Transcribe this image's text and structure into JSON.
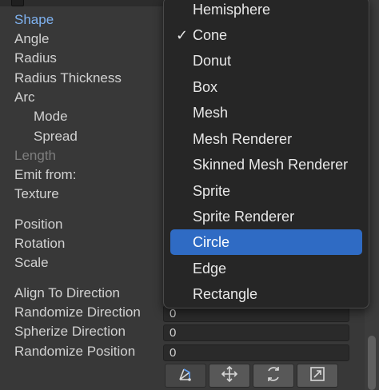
{
  "inspector": {
    "labels": {
      "shape": "Shape",
      "angle": "Angle",
      "radius": "Radius",
      "radius_thickness": "Radius Thickness",
      "arc": "Arc",
      "mode": "Mode",
      "spread": "Spread",
      "length": "Length",
      "emit_from": "Emit from:",
      "texture": "Texture",
      "position": "Position",
      "rotation": "Rotation",
      "scale": "Scale",
      "align_to_direction": "Align To Direction",
      "randomize_direction": "Randomize Direction",
      "spherize_direction": "Spherize Direction",
      "randomize_position": "Randomize Position"
    },
    "values": {
      "randomize_direction": "0",
      "spherize_direction": "0",
      "randomize_position": "0"
    }
  },
  "shape_menu": {
    "selected": "Cone",
    "highlighted": "Circle",
    "check_glyph": "✓",
    "items": [
      "Hemisphere",
      "Cone",
      "Donut",
      "Box",
      "Mesh",
      "Mesh Renderer",
      "Skinned Mesh Renderer",
      "Sprite",
      "Sprite Renderer",
      "Circle",
      "Edge",
      "Rectangle"
    ]
  },
  "toolbar": {
    "buttons": [
      "edit-shape-icon",
      "move-icon",
      "rotate-icon",
      "scale-icon"
    ]
  },
  "colors": {
    "panel_bg": "#383838",
    "menu_bg": "#262626",
    "highlight": "#2f6bc4",
    "active_label": "#7fb2f0"
  }
}
